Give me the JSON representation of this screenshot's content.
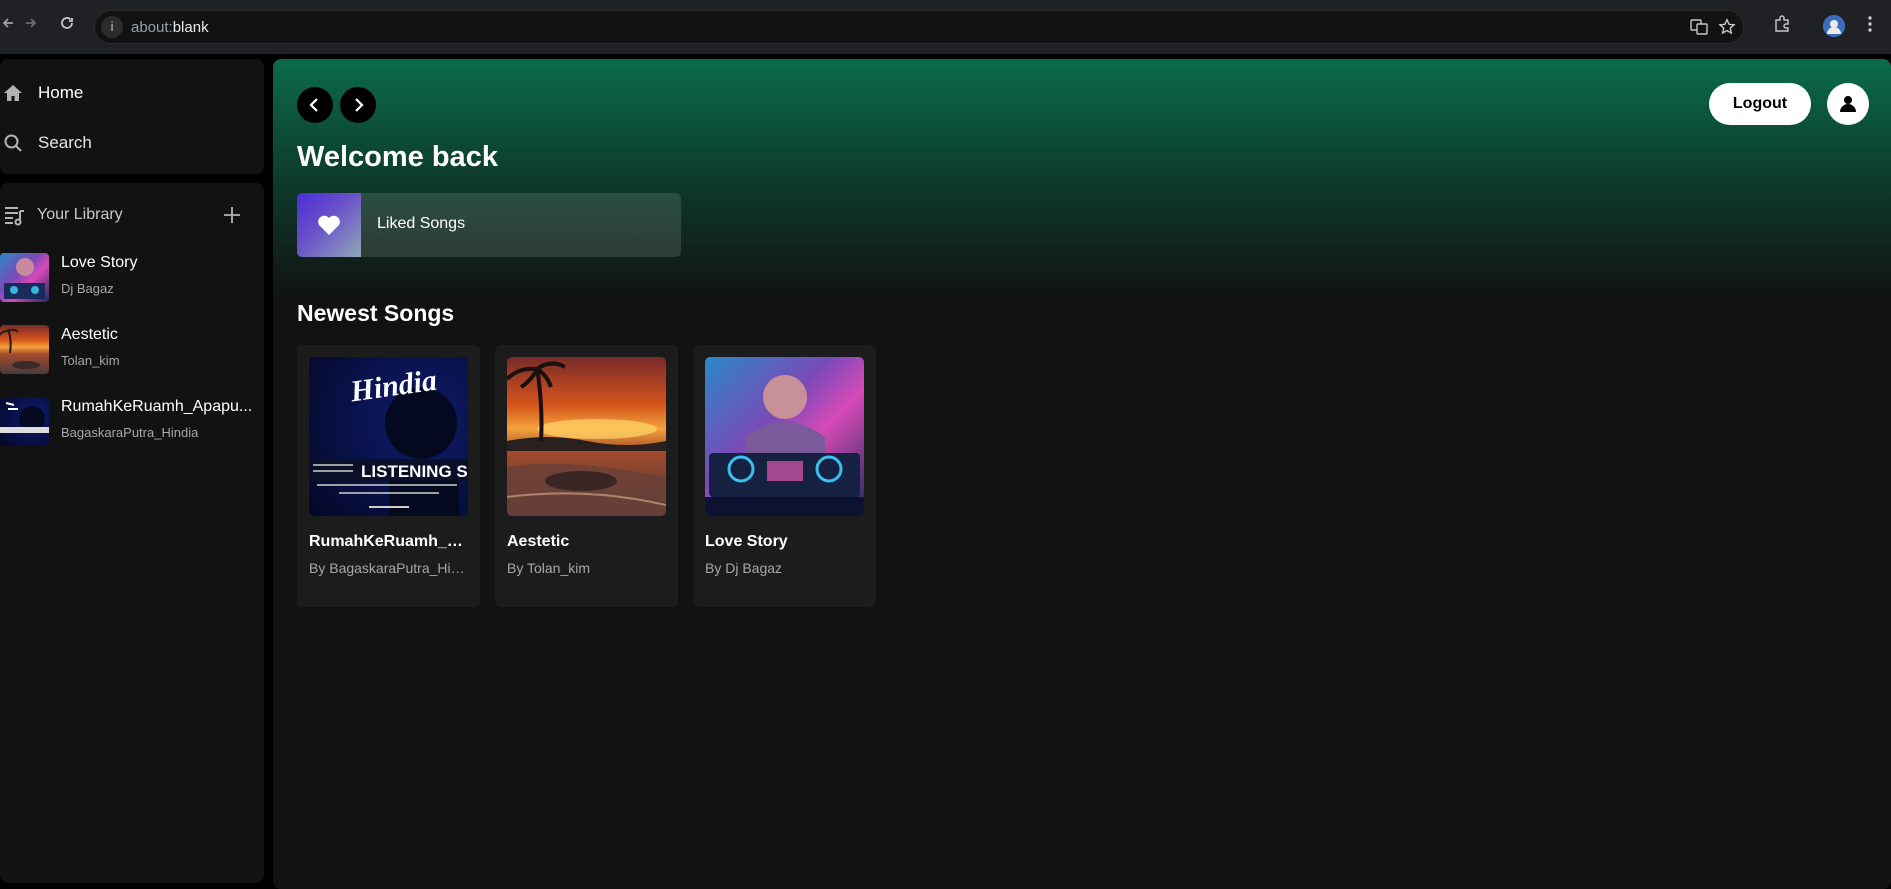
{
  "browser": {
    "url_prefix": "about:",
    "url_main": "blank"
  },
  "sidebar": {
    "nav": [
      {
        "label": "Home",
        "icon": "home-icon"
      },
      {
        "label": "Search",
        "icon": "search-icon"
      }
    ],
    "library": {
      "title": "Your Library",
      "items": [
        {
          "title": "Love Story",
          "subtitle": "Dj Bagaz",
          "art": "dj"
        },
        {
          "title": "Aestetic",
          "subtitle": "Tolan_kim",
          "art": "beach"
        },
        {
          "title": "RumahKeRuamh_Apapu...",
          "subtitle": "BagaskaraPutra_Hindia",
          "art": "hindia"
        }
      ]
    }
  },
  "main": {
    "logout_label": "Logout",
    "welcome": "Welcome back",
    "liked_songs": "Liked Songs",
    "section_title": "Newest Songs",
    "cards": [
      {
        "title": "RumahKeRuamh_Ap...",
        "subtitle": "By BagaskaraPutra_Hin...",
        "art": "hindia"
      },
      {
        "title": "Aestetic",
        "subtitle": "By Tolan_kim",
        "art": "beach"
      },
      {
        "title": "Love Story",
        "subtitle": "By Dj Bagaz",
        "art": "dj"
      }
    ],
    "hindia_art_text": {
      "logo": "Hindia",
      "banner": "LISTENING SES"
    }
  },
  "colors": {
    "accent_gradient_top": "#0b6b4a",
    "background": "#121212",
    "liked_gradient": "#4b2fd6"
  }
}
